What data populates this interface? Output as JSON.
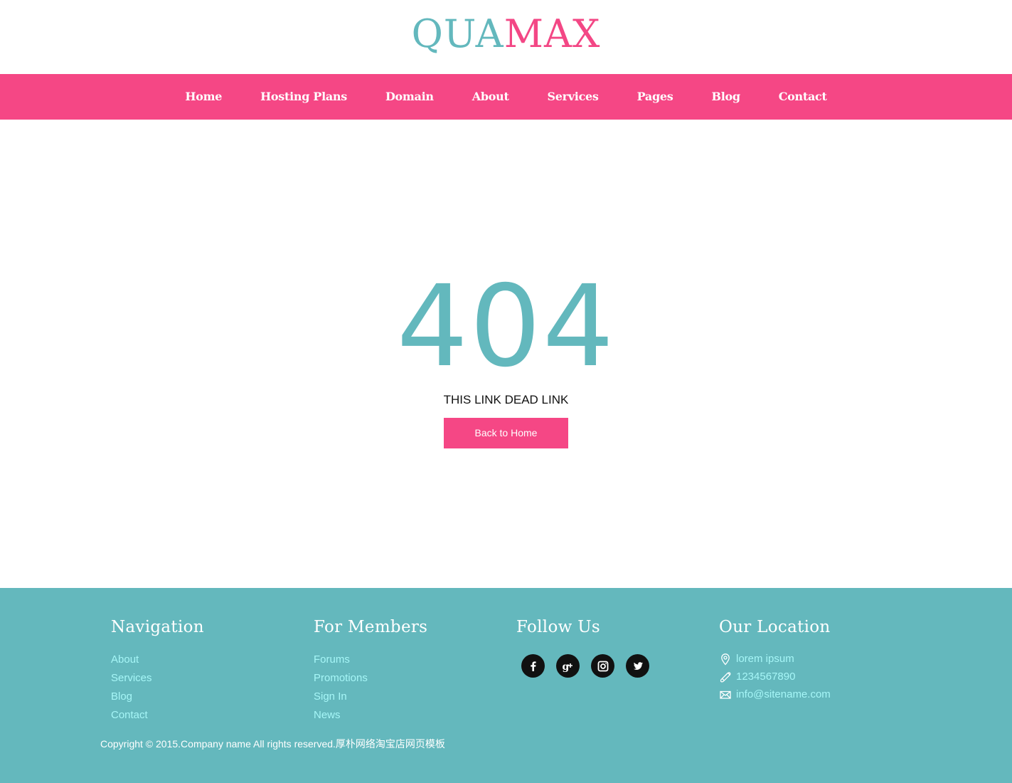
{
  "logo": {
    "part1": "QUA",
    "part2": "MAX"
  },
  "nav": {
    "items": [
      {
        "label": "Home"
      },
      {
        "label": "Hosting Plans"
      },
      {
        "label": "Domain"
      },
      {
        "label": "About"
      },
      {
        "label": "Services"
      },
      {
        "label": "Pages"
      },
      {
        "label": "Blog"
      },
      {
        "label": "Contact"
      }
    ]
  },
  "error": {
    "code": "404",
    "message": "THIS LINK DEAD LINK",
    "button_label": "Back to Home"
  },
  "footer": {
    "navigation": {
      "title": "Navigation",
      "links": [
        "About",
        "Services",
        "Blog",
        "Contact"
      ]
    },
    "members": {
      "title": "For Members",
      "links": [
        "Forums",
        "Promotions",
        "Sign In",
        "News"
      ]
    },
    "follow": {
      "title": "Follow Us",
      "icons": [
        "facebook-icon",
        "google-plus-icon",
        "instagram-icon",
        "twitter-icon"
      ]
    },
    "location": {
      "title": "Our Location",
      "address": "lorem ipsum",
      "phone": "1234567890",
      "email": "info@sitename.com"
    },
    "copyright": "Copyright © 2015.Company name All rights reserved.厚朴网络淘宝店网页模板"
  },
  "colors": {
    "accent_pink": "#f54785",
    "accent_teal": "#64b8bd",
    "footer_link": "#a6f6f7"
  }
}
